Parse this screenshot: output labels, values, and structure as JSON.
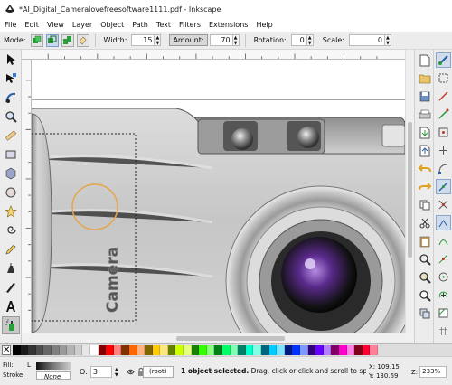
{
  "window": {
    "title": "*AI_Digital_Cameralovefreesoftware1111.pdf - Inkscape"
  },
  "menu": [
    "File",
    "Edit",
    "View",
    "Layer",
    "Object",
    "Path",
    "Text",
    "Filters",
    "Extensions",
    "Help"
  ],
  "tool_controls": {
    "mode_label": "Mode:",
    "width_label": "Width:",
    "width_value": "15",
    "amount_label": "Amount:",
    "amount_value": "70",
    "rotation_label": "Rotation:",
    "rotation_value": "0",
    "scale_label": "Scale:",
    "scale_value": "0"
  },
  "canvas": {
    "camera_text": "Camera"
  },
  "status": {
    "fill_label": "Fill:",
    "fill_value": "L",
    "stroke_label": "Stroke:",
    "stroke_value": "None",
    "opacity_label": "O:",
    "opacity_value": "3",
    "layer_value": "(root)",
    "message_bold": "1 object selected.",
    "message_rest": " Drag, click or click and scroll to spray c...",
    "x_label": "X:",
    "x_value": "109.15",
    "y_label": "Y:",
    "y_value": "130.69",
    "zoom_label": "Z:",
    "zoom_value": "233%"
  },
  "colors": {
    "accent": "#2a9d3a",
    "selection_blue": "#3b7bd8",
    "circle_orange": "#e8a44a"
  }
}
